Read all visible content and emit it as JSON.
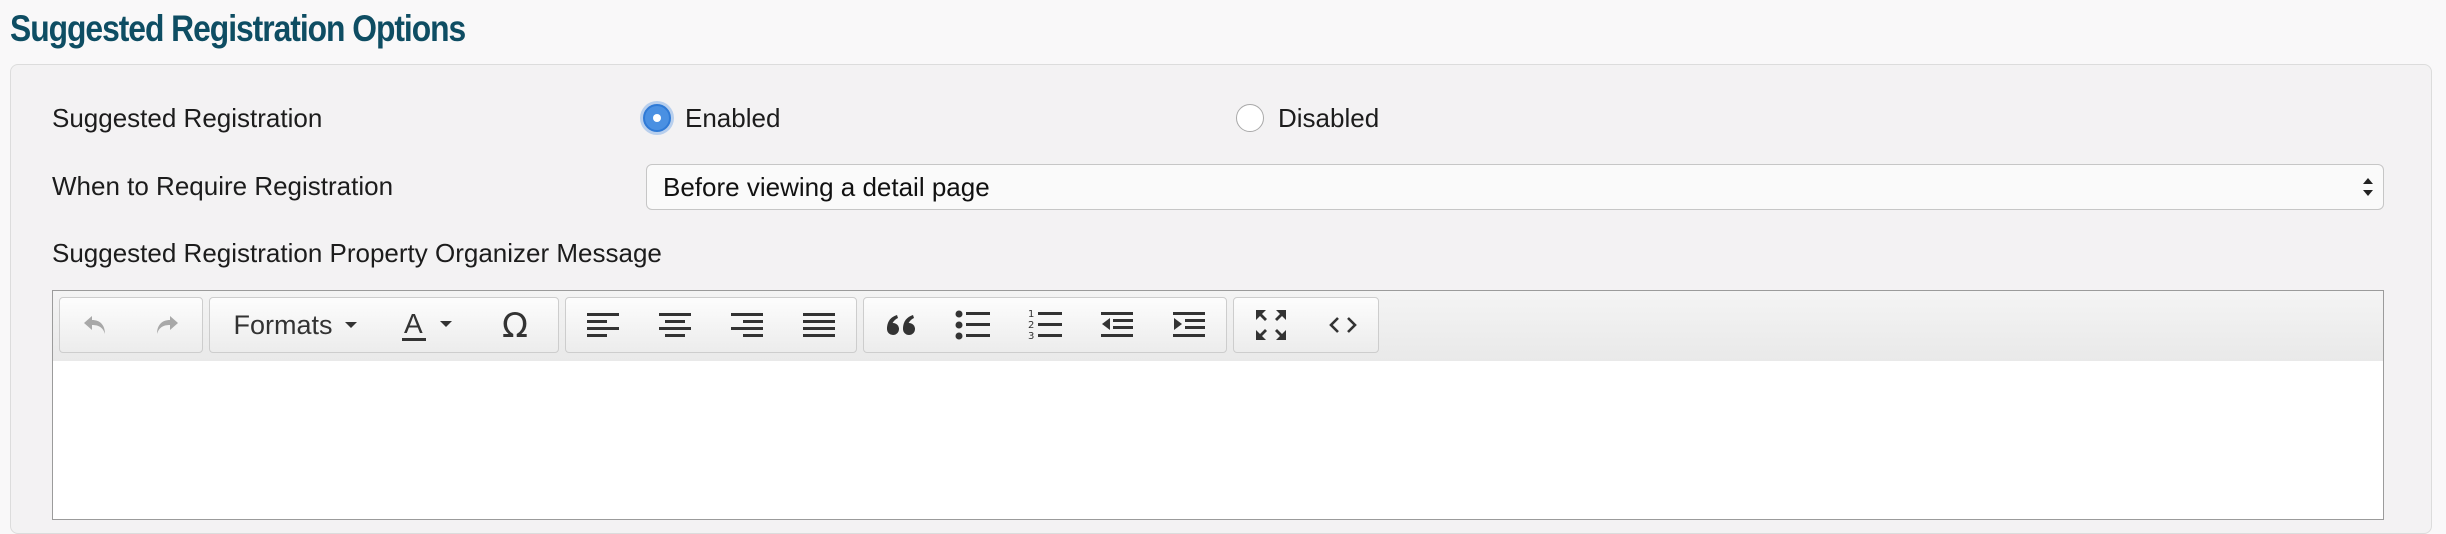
{
  "section": {
    "title": "Suggested Registration Options"
  },
  "suggested_registration": {
    "label": "Suggested Registration",
    "options": [
      {
        "label": "Enabled",
        "checked": true
      },
      {
        "label": "Disabled",
        "checked": false
      }
    ]
  },
  "require_registration": {
    "label": "When to Require Registration",
    "selected": "Before viewing a detail page"
  },
  "organizer_message": {
    "label": "Suggested Registration Property Organizer Message",
    "content": ""
  },
  "toolbar": {
    "formats_label": "Formats",
    "buttons": [
      "undo-icon",
      "redo-icon",
      "text-color-icon",
      "special-character-icon",
      "align-left-icon",
      "align-center-icon",
      "align-right-icon",
      "align-justify-icon",
      "blockquote-icon",
      "bullet-list-icon",
      "numbered-list-icon",
      "outdent-icon",
      "indent-icon",
      "fullscreen-icon",
      "source-code-icon"
    ]
  },
  "colors": {
    "title": "#0e4d63",
    "radio_accent": "#4a90e2"
  }
}
